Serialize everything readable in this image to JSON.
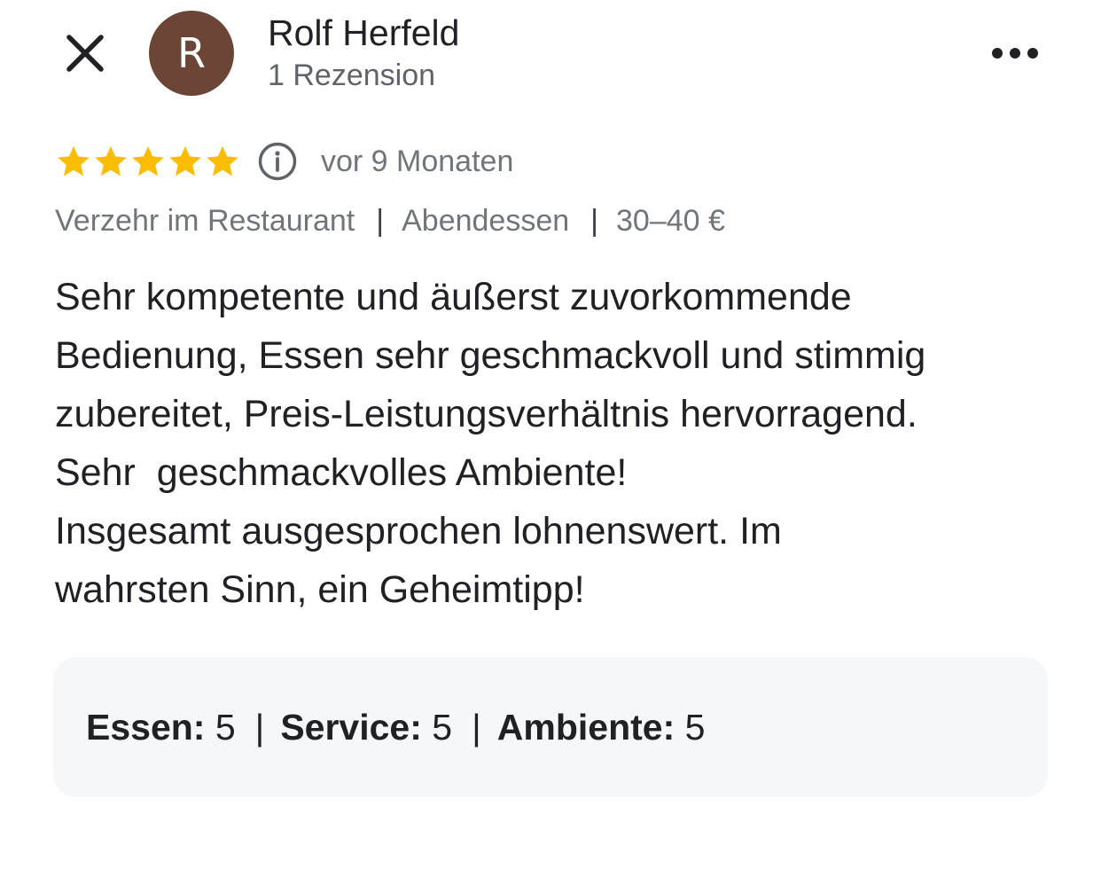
{
  "header": {
    "close_icon": "close-icon",
    "avatar_letter": "R",
    "avatar_color": "#6b4536",
    "author_name": "Rolf Herfeld",
    "review_count": "1 Rezension",
    "more_icon": "more-horizontal-icon"
  },
  "rating": {
    "stars": 5,
    "star_color": "#fbbc04",
    "info_icon": "info-icon",
    "time_ago": "vor 9 Monaten"
  },
  "meta": {
    "items": [
      "Verzehr im Restaurant",
      "Abendessen",
      "30–40 €"
    ],
    "separator": "|"
  },
  "review": {
    "text": "Sehr kompetente und äußerst zuvorkommende\nBedienung, Essen sehr geschmackvoll und stimmig\nzubereitet, Preis-Leistungsverhältnis hervorragend.\nSehr  geschmackvolles Ambiente!\nInsgesamt ausgesprochen lohnenswert. Im\nwahrsten Sinn, ein Geheimtipp!"
  },
  "subratings": {
    "separator": "|",
    "items": [
      {
        "label": "Essen:",
        "value": "5"
      },
      {
        "label": "Service:",
        "value": "5"
      },
      {
        "label": "Ambiente:",
        "value": "5"
      }
    ]
  }
}
